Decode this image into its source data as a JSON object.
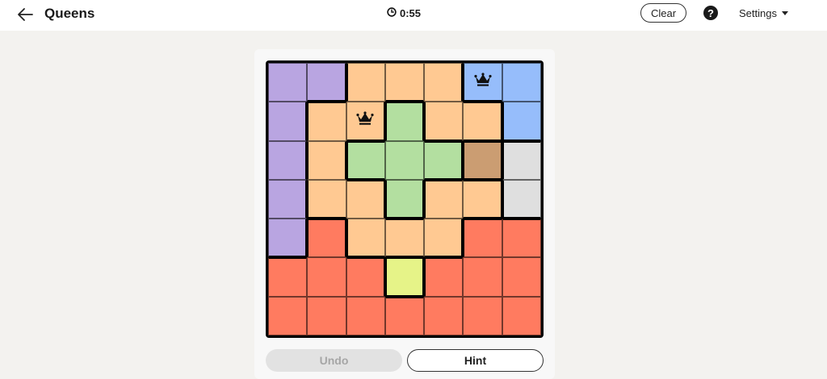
{
  "header": {
    "title": "Queens",
    "timer": "0:55",
    "clear_label": "Clear",
    "help_label": "?",
    "settings_label": "Settings"
  },
  "colors": {
    "purple": "#b9a5e1",
    "orange": "#ffc992",
    "blue": "#96bdfb",
    "green": "#b3dfa0",
    "brown": "#cb9d72",
    "gray": "#dfdfdf",
    "red": "#ff7b60",
    "yellow": "#e6f388"
  },
  "board": {
    "size": 7,
    "regions": [
      [
        "purple",
        "purple",
        "orange",
        "orange",
        "orange",
        "blue",
        "blue"
      ],
      [
        "purple",
        "orange",
        "orange",
        "green",
        "orange",
        "orange",
        "blue"
      ],
      [
        "purple",
        "orange",
        "green",
        "green",
        "green",
        "brown",
        "gray"
      ],
      [
        "purple",
        "orange",
        "orange",
        "green",
        "orange",
        "orange",
        "gray"
      ],
      [
        "purple",
        "red",
        "orange",
        "orange",
        "orange",
        "red",
        "red"
      ],
      [
        "red",
        "red",
        "red",
        "yellow",
        "red",
        "red",
        "red"
      ],
      [
        "red",
        "red",
        "red",
        "red",
        "red",
        "red",
        "red"
      ]
    ],
    "queens": [
      [
        0,
        5
      ],
      [
        1,
        2
      ]
    ]
  },
  "controls": {
    "undo_label": "Undo",
    "hint_label": "Hint"
  }
}
